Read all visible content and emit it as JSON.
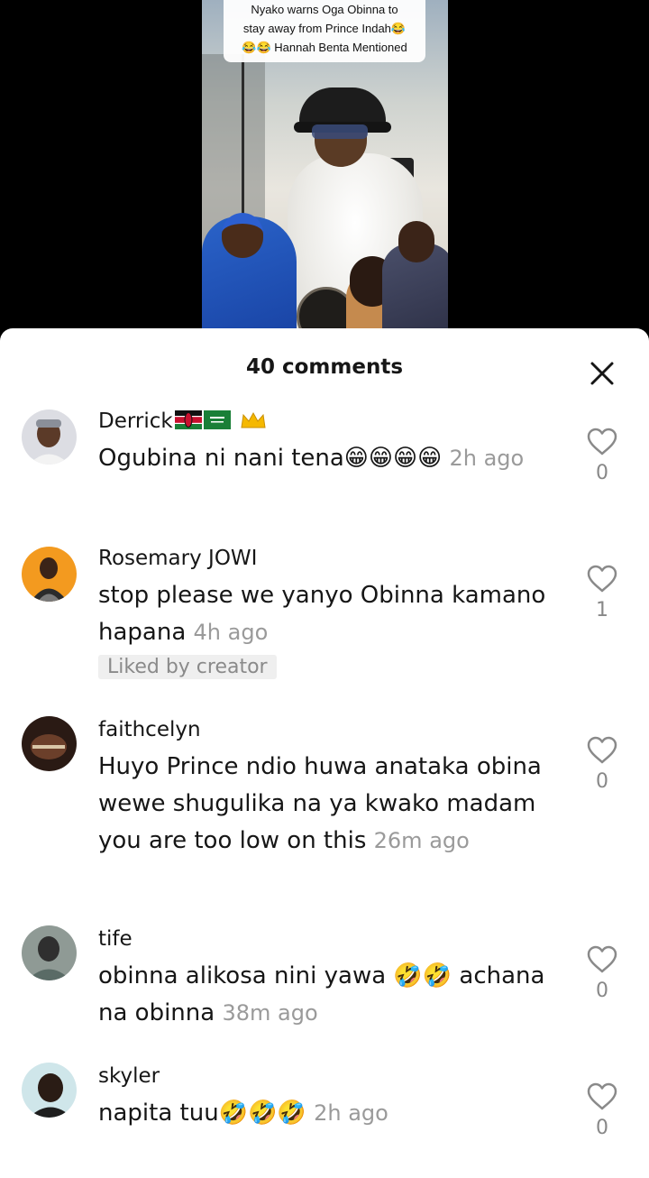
{
  "video": {
    "caption_line1": "Nyako warns Oga Obinna to",
    "caption_line2": "stay away from Prince Indah😂",
    "caption_line3": "😂😂 Hannah Benta Mentioned"
  },
  "sheet": {
    "title": "40 comments",
    "close_icon": "close-icon"
  },
  "comments": [
    {
      "user": "Derrick",
      "user_suffix": "🇰🇪🇸🇦 👑",
      "text": "Ogubina ni nani tena😁😁😁😁",
      "time": "2h ago",
      "likes": "0",
      "liked_by_creator": false
    },
    {
      "user": "Rosemary JOWI",
      "text": "stop please we yanyo Obinna kamano hapana",
      "time": "4h ago",
      "likes": "1",
      "liked_by_creator": true,
      "liked_label": "Liked by creator"
    },
    {
      "user": "faithcelyn",
      "text": "Huyo Prince ndio huwa anataka obina wewe shugulika na ya kwako madam you are too low on this",
      "time": "26m ago",
      "likes": "0",
      "liked_by_creator": false
    },
    {
      "user": "tife",
      "text": "obinna alikosa nini yawa 🤣🤣 achana na obinna",
      "time": "38m ago",
      "likes": "0",
      "liked_by_creator": false
    },
    {
      "user": "skyler",
      "text": "napita tuu🤣🤣🤣",
      "time": "2h ago",
      "likes": "0",
      "liked_by_creator": false
    }
  ],
  "colors": {
    "sheet_bg": "#ffffff",
    "text_primary": "#161616",
    "text_secondary": "#9a9a9a",
    "badge_bg": "#efefef"
  }
}
